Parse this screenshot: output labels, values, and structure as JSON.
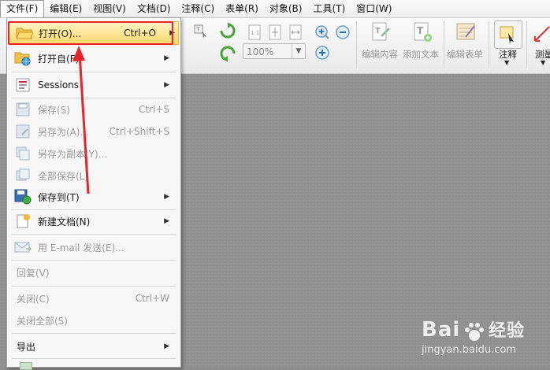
{
  "menubar": [
    "文件(F)",
    "编辑(E)",
    "视图(V)",
    "文档(D)",
    "注释(C)",
    "表单(R)",
    "对象(B)",
    "工具(T)",
    "窗口(W)"
  ],
  "toolbar": {
    "zoom": "100%",
    "edit_content": "编辑内容",
    "add_text": "添加文本",
    "edit_form": "编辑表单",
    "comment": "注释",
    "measure": "测量"
  },
  "file_menu": {
    "open": {
      "label": "打开(O)...",
      "shortcut": "Ctrl+O"
    },
    "open_from": {
      "label": "打开自(F)"
    },
    "sessions": {
      "label": "Sessions"
    },
    "save": {
      "label": "保存(S)",
      "shortcut": "Ctrl+S"
    },
    "save_as": {
      "label": "另存为(A)...",
      "shortcut": "Ctrl+Shift+S"
    },
    "save_copy": {
      "label": "另存为副本(Y)..."
    },
    "save_all": {
      "label": "全部保存(L)"
    },
    "save_to": {
      "label": "保存到(T)"
    },
    "new_doc": {
      "label": "新建文档(N)"
    },
    "email": {
      "label": "用 E-mail 发送(E)..."
    },
    "revert": {
      "label": "回复(V)"
    },
    "close": {
      "label": "关闭(C)",
      "shortcut": "Ctrl+W"
    },
    "close_all": {
      "label": "关闭全部(S)"
    },
    "export": {
      "label": "导出"
    }
  },
  "watermark": {
    "brand": "Bai",
    "brand2": "经验",
    "url": "jingyan.baidu.com"
  },
  "colors": {
    "highlight": "#ffd86a",
    "annotation_red": "#e8242a"
  }
}
